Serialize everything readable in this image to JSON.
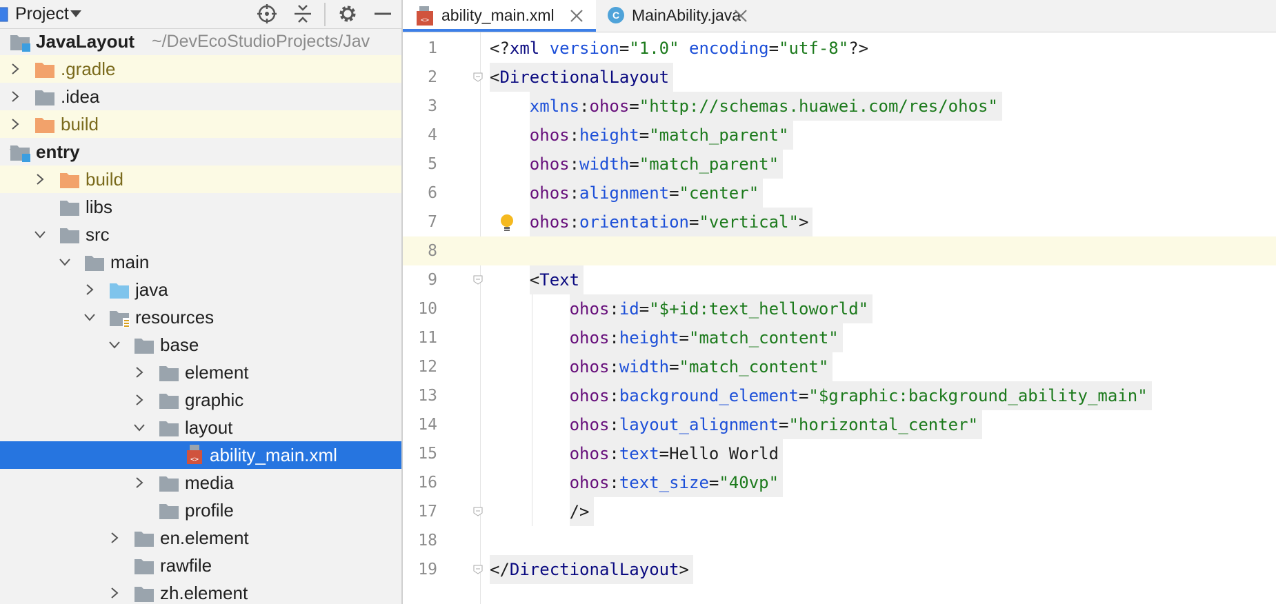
{
  "project_panel": {
    "title": "Project",
    "tree": [
      {
        "label": "JavaLayout",
        "path": "~/DevEcoStudioProjects/Jav",
        "depth": 0,
        "chevron": "none",
        "folder": "module",
        "bold": true,
        "highlight": false
      },
      {
        "label": ".gradle",
        "depth": 0,
        "chevron": "right",
        "folder": "orange",
        "bold": false,
        "highlight": true,
        "excluded": true
      },
      {
        "label": ".idea",
        "depth": 0,
        "chevron": "right",
        "folder": "grey",
        "bold": false,
        "highlight": false
      },
      {
        "label": "build",
        "depth": 0,
        "chevron": "right",
        "folder": "orange",
        "bold": false,
        "highlight": true,
        "excluded": true
      },
      {
        "label": "entry",
        "depth": 0,
        "chevron": "down",
        "folder": "module",
        "bold": true,
        "highlight": false
      },
      {
        "label": "build",
        "depth": 1,
        "chevron": "right",
        "folder": "orange",
        "bold": false,
        "highlight": true,
        "excluded": true
      },
      {
        "label": "libs",
        "depth": 1,
        "chevron": "none",
        "folder": "grey",
        "bold": false,
        "highlight": false
      },
      {
        "label": "src",
        "depth": 1,
        "chevron": "down",
        "folder": "grey",
        "bold": false,
        "highlight": false
      },
      {
        "label": "main",
        "depth": 2,
        "chevron": "down",
        "folder": "grey",
        "bold": false,
        "highlight": false
      },
      {
        "label": "java",
        "depth": 3,
        "chevron": "right",
        "folder": "blue",
        "bold": false,
        "highlight": false
      },
      {
        "label": "resources",
        "depth": 3,
        "chevron": "down",
        "folder": "resources",
        "bold": false,
        "highlight": false
      },
      {
        "label": "base",
        "depth": 4,
        "chevron": "down",
        "folder": "grey",
        "bold": false,
        "highlight": false
      },
      {
        "label": "element",
        "depth": 5,
        "chevron": "right",
        "folder": "grey",
        "bold": false,
        "highlight": false
      },
      {
        "label": "graphic",
        "depth": 5,
        "chevron": "right",
        "folder": "grey",
        "bold": false,
        "highlight": false
      },
      {
        "label": "layout",
        "depth": 5,
        "chevron": "down",
        "folder": "grey",
        "bold": false,
        "highlight": false
      },
      {
        "label": "ability_main.xml",
        "depth": 6,
        "chevron": "none",
        "folder": "xmlfile",
        "bold": false,
        "highlight": false,
        "selected": true
      },
      {
        "label": "media",
        "depth": 5,
        "chevron": "right",
        "folder": "grey",
        "bold": false,
        "highlight": false
      },
      {
        "label": "profile",
        "depth": 5,
        "chevron": "none",
        "folder": "grey",
        "bold": false,
        "highlight": false
      },
      {
        "label": "en.element",
        "depth": 4,
        "chevron": "right",
        "folder": "grey",
        "bold": false,
        "highlight": false
      },
      {
        "label": "rawfile",
        "depth": 4,
        "chevron": "none",
        "folder": "grey",
        "bold": false,
        "highlight": false
      },
      {
        "label": "zh.element",
        "depth": 4,
        "chevron": "right",
        "folder": "grey",
        "bold": false,
        "highlight": false
      }
    ]
  },
  "tabs": [
    {
      "label": "ability_main.xml",
      "active": true,
      "icon": "xml-file-icon"
    },
    {
      "label": "MainAbility.java",
      "active": false,
      "icon": "java-class-icon"
    }
  ],
  "editor": {
    "lines": [
      {
        "n": "1",
        "tokens": [
          [
            "tok-pi",
            "<?"
          ],
          [
            "tok-xml",
            "xml "
          ],
          [
            "attr",
            "version"
          ],
          [
            "eq",
            "="
          ],
          [
            "str",
            "\"1.0\""
          ],
          [
            "plain",
            " "
          ],
          [
            "attr",
            "encoding"
          ],
          [
            "eq",
            "="
          ],
          [
            "str",
            "\"utf-8\""
          ],
          [
            "tok-pi",
            "?>"
          ]
        ],
        "indent": 0
      },
      {
        "n": "2",
        "tokens": [
          [
            "plain",
            "<"
          ],
          [
            "tagname",
            "DirectionalLayout"
          ]
        ],
        "indent": 0,
        "grey": true
      },
      {
        "n": "3",
        "tokens": [
          [
            "attr",
            "xmlns"
          ],
          [
            "eq",
            ":"
          ],
          [
            "ns",
            "ohos"
          ],
          [
            "eq",
            "="
          ],
          [
            "str",
            "\"http://schemas.huawei.com/res/ohos\""
          ]
        ],
        "indent": 1,
        "grey": true
      },
      {
        "n": "4",
        "tokens": [
          [
            "ns",
            "ohos"
          ],
          [
            "eq",
            ":"
          ],
          [
            "attr",
            "height"
          ],
          [
            "eq",
            "="
          ],
          [
            "str",
            "\"match_parent\""
          ]
        ],
        "indent": 1,
        "grey": true
      },
      {
        "n": "5",
        "tokens": [
          [
            "ns",
            "ohos"
          ],
          [
            "eq",
            ":"
          ],
          [
            "attr",
            "width"
          ],
          [
            "eq",
            "="
          ],
          [
            "str",
            "\"match_parent\""
          ]
        ],
        "indent": 1,
        "grey": true
      },
      {
        "n": "6",
        "tokens": [
          [
            "ns",
            "ohos"
          ],
          [
            "eq",
            ":"
          ],
          [
            "attr",
            "alignment"
          ],
          [
            "eq",
            "="
          ],
          [
            "str",
            "\"center\""
          ]
        ],
        "indent": 1,
        "grey": true
      },
      {
        "n": "7",
        "tokens": [
          [
            "ns",
            "ohos"
          ],
          [
            "eq",
            ":"
          ],
          [
            "attr",
            "orientation"
          ],
          [
            "eq",
            "="
          ],
          [
            "str",
            "\"vertical\""
          ],
          [
            "plain",
            ">"
          ]
        ],
        "indent": 1,
        "grey": true
      },
      {
        "n": "8",
        "tokens": [],
        "indent": 0,
        "caret": true
      },
      {
        "n": "9",
        "tokens": [
          [
            "plain",
            "<"
          ],
          [
            "tagname",
            "Text"
          ]
        ],
        "indent": 1,
        "grey": true
      },
      {
        "n": "10",
        "tokens": [
          [
            "ns",
            "ohos"
          ],
          [
            "eq",
            ":"
          ],
          [
            "attr",
            "id"
          ],
          [
            "eq",
            "="
          ],
          [
            "str",
            "\"$+id:text_helloworld\""
          ]
        ],
        "indent": 2,
        "grey": true
      },
      {
        "n": "11",
        "tokens": [
          [
            "ns",
            "ohos"
          ],
          [
            "eq",
            ":"
          ],
          [
            "attr",
            "height"
          ],
          [
            "eq",
            "="
          ],
          [
            "str",
            "\"match_content\""
          ]
        ],
        "indent": 2,
        "grey": true
      },
      {
        "n": "12",
        "tokens": [
          [
            "ns",
            "ohos"
          ],
          [
            "eq",
            ":"
          ],
          [
            "attr",
            "width"
          ],
          [
            "eq",
            "="
          ],
          [
            "str",
            "\"match_content\""
          ]
        ],
        "indent": 2,
        "grey": true
      },
      {
        "n": "13",
        "tokens": [
          [
            "ns",
            "ohos"
          ],
          [
            "eq",
            ":"
          ],
          [
            "attr",
            "background_element"
          ],
          [
            "eq",
            "="
          ],
          [
            "str",
            "\"$graphic:background_ability_main\""
          ]
        ],
        "indent": 2,
        "grey": true
      },
      {
        "n": "14",
        "tokens": [
          [
            "ns",
            "ohos"
          ],
          [
            "eq",
            ":"
          ],
          [
            "attr",
            "layout_alignment"
          ],
          [
            "eq",
            "="
          ],
          [
            "str",
            "\"horizontal_center\""
          ]
        ],
        "indent": 2,
        "grey": true
      },
      {
        "n": "15",
        "tokens": [
          [
            "ns",
            "ohos"
          ],
          [
            "eq",
            ":"
          ],
          [
            "attr",
            "text"
          ],
          [
            "eq",
            "="
          ],
          [
            "plain",
            "Hello World"
          ]
        ],
        "indent": 2,
        "grey": true
      },
      {
        "n": "16",
        "tokens": [
          [
            "ns",
            "ohos"
          ],
          [
            "eq",
            ":"
          ],
          [
            "attr",
            "text_size"
          ],
          [
            "eq",
            "="
          ],
          [
            "str",
            "\"40vp\""
          ]
        ],
        "indent": 2,
        "grey": true
      },
      {
        "n": "17",
        "tokens": [
          [
            "plain",
            "/>"
          ]
        ],
        "indent": 2,
        "grey": true
      },
      {
        "n": "18",
        "tokens": [],
        "indent": 0
      },
      {
        "n": "19",
        "tokens": [
          [
            "plain",
            "</"
          ],
          [
            "tagname",
            "DirectionalLayout"
          ],
          [
            "plain",
            ">"
          ]
        ],
        "indent": 0,
        "grey": true
      }
    ]
  },
  "colors": {
    "selection": "#2675e0",
    "excluded_highlight": "#fcfae4",
    "tab_underline": "#3c7fe8"
  }
}
